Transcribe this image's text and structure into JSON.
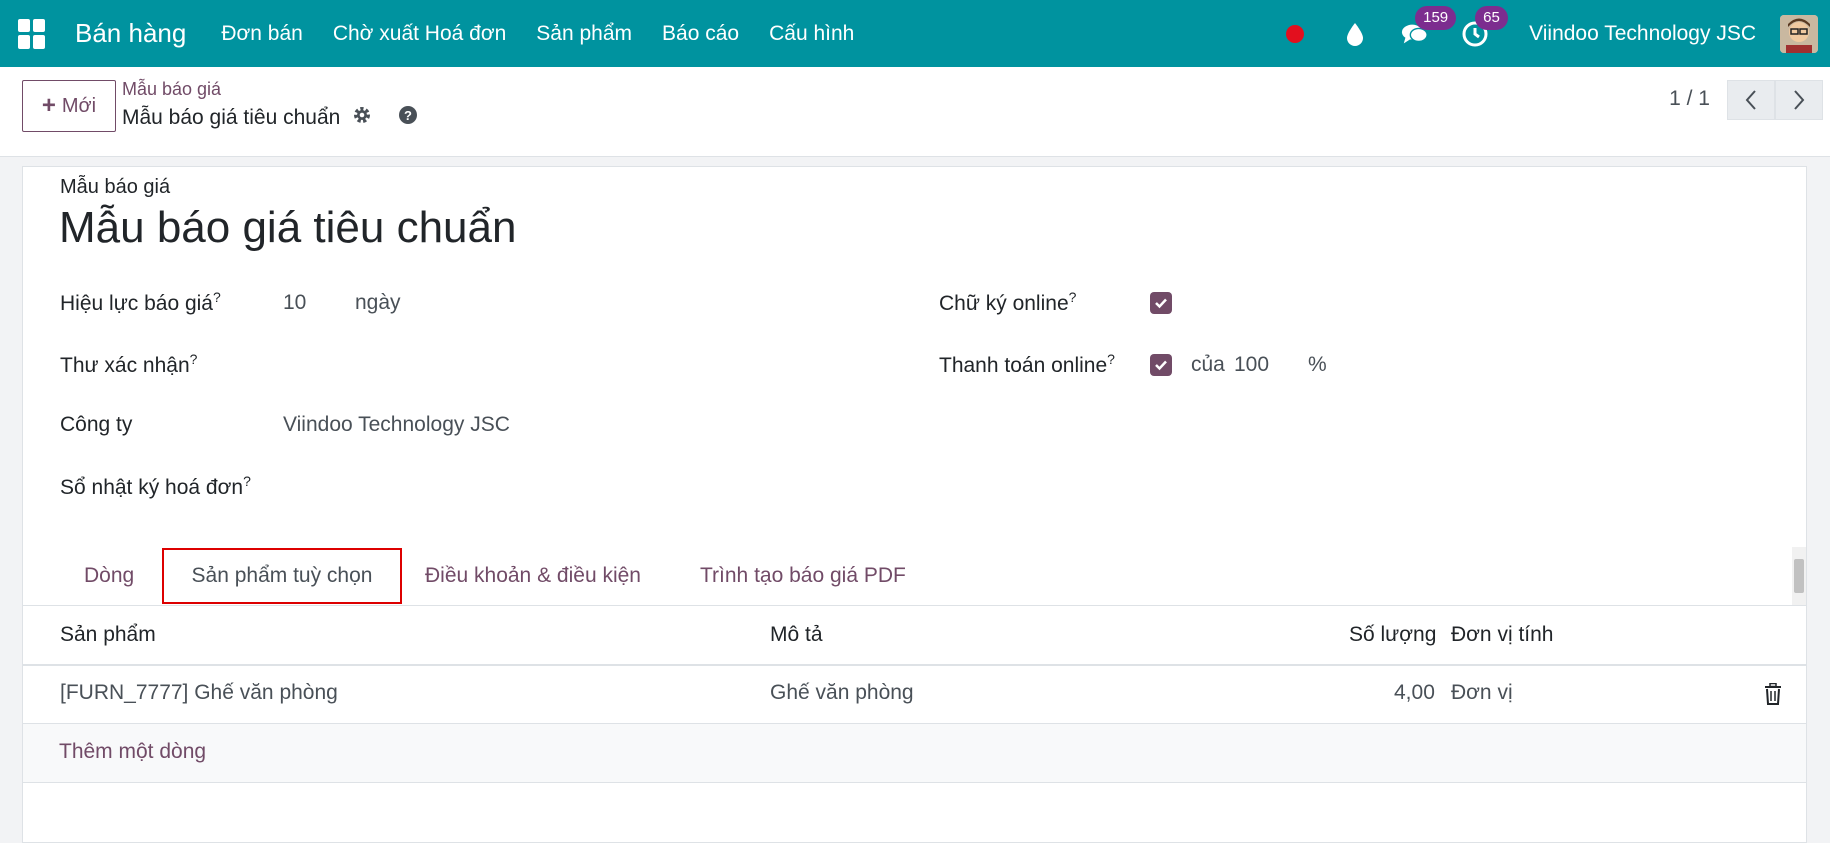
{
  "navbar": {
    "brand": "Bán hàng",
    "menu": [
      "Đơn bán",
      "Chờ xuất Hoá đơn",
      "Sản phẩm",
      "Báo cáo",
      "Cấu hình"
    ],
    "messages_count": "159",
    "activities_count": "65",
    "company": "Viindoo Technology JSC"
  },
  "control": {
    "new_label": "Mới",
    "breadcrumb_parent": "Mẫu báo giá",
    "breadcrumb_current": "Mẫu báo giá tiêu chuẩn",
    "pager": "1 / 1"
  },
  "form": {
    "small_label": "Mẫu báo giá",
    "title": "Mẫu báo giá tiêu chuẩn",
    "validity_label": "Hiệu lực báo giá",
    "validity_value": "10",
    "validity_unit": "ngày",
    "confirmation_mail_label": "Thư xác nhận",
    "company_label": "Công ty",
    "company_value": "Viindoo Technology JSC",
    "journal_label": "Sổ nhật ký hoá đơn",
    "online_signature_label": "Chữ ký online",
    "online_signature_checked": true,
    "online_payment_label": "Thanh toán online",
    "online_payment_checked": true,
    "payment_of": "của",
    "payment_percent": "100",
    "percent_sign": "%",
    "help_mark": "?"
  },
  "tabs": [
    "Dòng",
    "Sản phẩm tuỳ chọn",
    "Điều khoản & điều kiện",
    "Trình tạo báo giá PDF"
  ],
  "table": {
    "headers": [
      "Sản phẩm",
      "Mô tả",
      "Số lượng",
      "Đơn vị tính"
    ],
    "rows": [
      {
        "product": "[FURN_7777] Ghế văn phòng",
        "description": "Ghế văn phòng",
        "quantity": "4,00",
        "uom": "Đơn vị"
      }
    ],
    "add_line": "Thêm một dòng"
  },
  "colors": {
    "navbar": "#00939f",
    "accent": "#714b67",
    "highlight": "#dd0000"
  }
}
